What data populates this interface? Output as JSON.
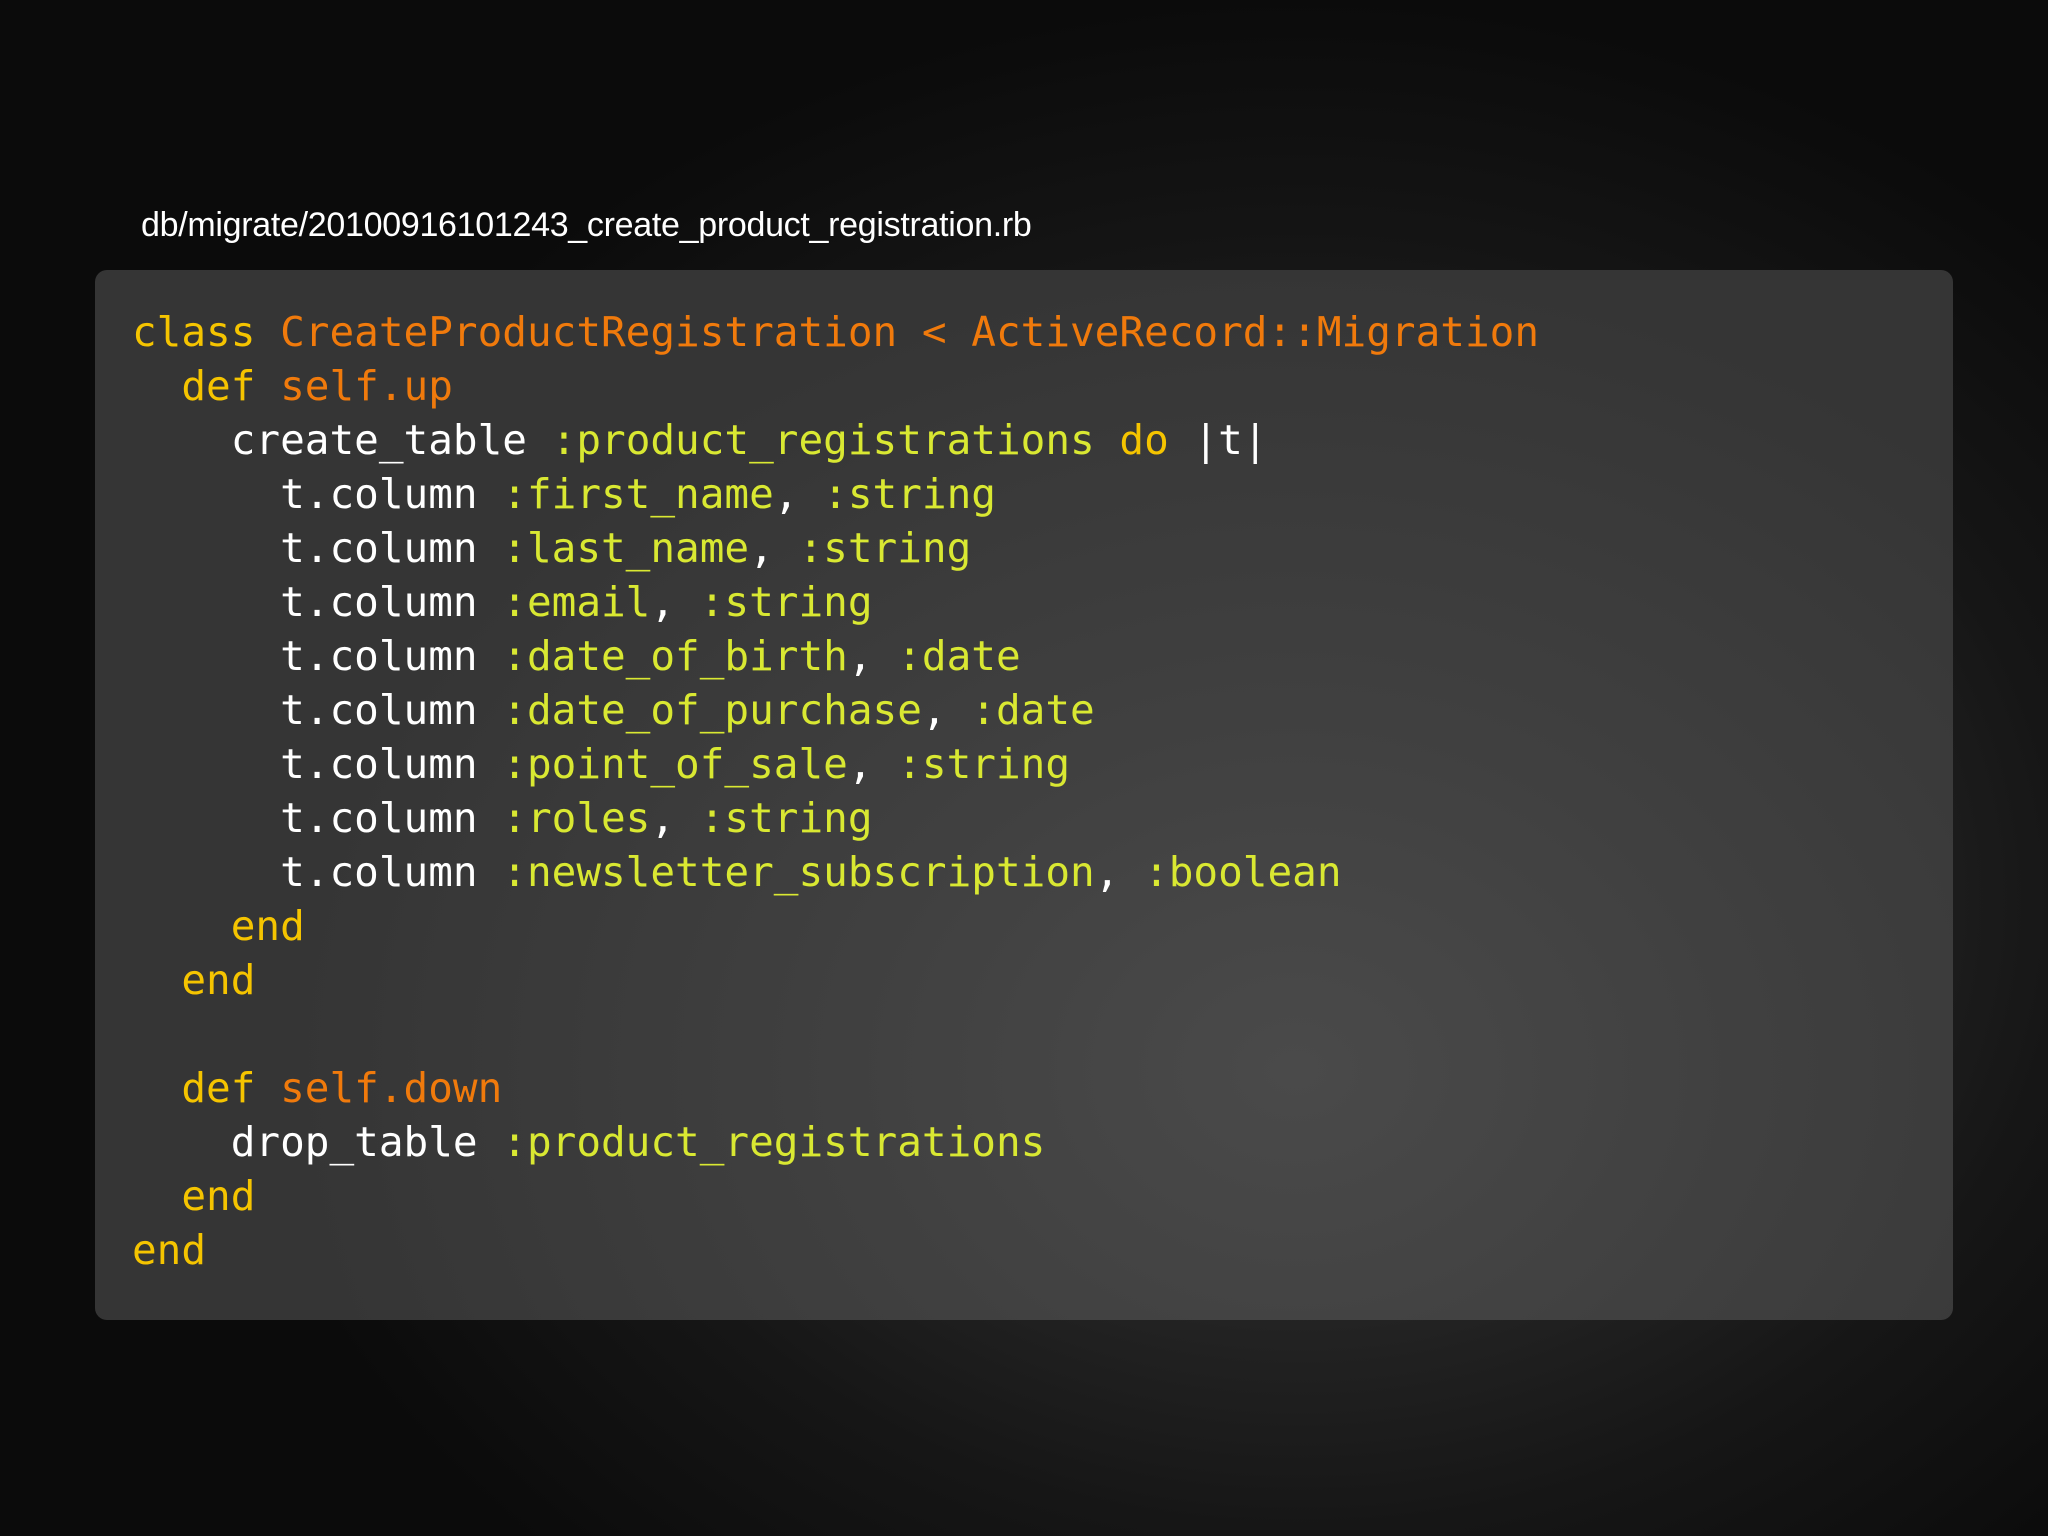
{
  "file_path": "db/migrate/20100916101243_create_product_registration.rb",
  "colors": {
    "keyword": "#f5c400",
    "class_name": "#f07a0c",
    "symbol": "#d9e832",
    "plain": "#ffffff"
  },
  "code_lines": [
    [
      {
        "text": "class",
        "kind": "keyword"
      },
      {
        "text": " ",
        "kind": "plain"
      },
      {
        "text": "CreateProductRegistration < ActiveRecord::Migration",
        "kind": "class_name"
      }
    ],
    [
      {
        "text": "  ",
        "kind": "plain"
      },
      {
        "text": "def",
        "kind": "keyword"
      },
      {
        "text": " ",
        "kind": "plain"
      },
      {
        "text": "self.up",
        "kind": "class_name"
      }
    ],
    [
      {
        "text": "    create_table ",
        "kind": "plain"
      },
      {
        "text": ":product_registrations",
        "kind": "symbol"
      },
      {
        "text": " ",
        "kind": "plain"
      },
      {
        "text": "do",
        "kind": "keyword"
      },
      {
        "text": " |t|",
        "kind": "plain"
      }
    ],
    [
      {
        "text": "      t.column ",
        "kind": "plain"
      },
      {
        "text": ":first_name",
        "kind": "symbol"
      },
      {
        "text": ", ",
        "kind": "plain"
      },
      {
        "text": ":string",
        "kind": "symbol"
      }
    ],
    [
      {
        "text": "      t.column ",
        "kind": "plain"
      },
      {
        "text": ":last_name",
        "kind": "symbol"
      },
      {
        "text": ", ",
        "kind": "plain"
      },
      {
        "text": ":string",
        "kind": "symbol"
      }
    ],
    [
      {
        "text": "      t.column ",
        "kind": "plain"
      },
      {
        "text": ":email",
        "kind": "symbol"
      },
      {
        "text": ", ",
        "kind": "plain"
      },
      {
        "text": ":string",
        "kind": "symbol"
      }
    ],
    [
      {
        "text": "      t.column ",
        "kind": "plain"
      },
      {
        "text": ":date_of_birth",
        "kind": "symbol"
      },
      {
        "text": ", ",
        "kind": "plain"
      },
      {
        "text": ":date",
        "kind": "symbol"
      }
    ],
    [
      {
        "text": "      t.column ",
        "kind": "plain"
      },
      {
        "text": ":date_of_purchase",
        "kind": "symbol"
      },
      {
        "text": ", ",
        "kind": "plain"
      },
      {
        "text": ":date",
        "kind": "symbol"
      }
    ],
    [
      {
        "text": "      t.column ",
        "kind": "plain"
      },
      {
        "text": ":point_of_sale",
        "kind": "symbol"
      },
      {
        "text": ", ",
        "kind": "plain"
      },
      {
        "text": ":string",
        "kind": "symbol"
      }
    ],
    [
      {
        "text": "      t.column ",
        "kind": "plain"
      },
      {
        "text": ":roles",
        "kind": "symbol"
      },
      {
        "text": ", ",
        "kind": "plain"
      },
      {
        "text": ":string",
        "kind": "symbol"
      }
    ],
    [
      {
        "text": "      t.column ",
        "kind": "plain"
      },
      {
        "text": ":newsletter_subscription",
        "kind": "symbol"
      },
      {
        "text": ", ",
        "kind": "plain"
      },
      {
        "text": ":boolean",
        "kind": "symbol"
      }
    ],
    [
      {
        "text": "    ",
        "kind": "plain"
      },
      {
        "text": "end",
        "kind": "keyword"
      }
    ],
    [
      {
        "text": "  ",
        "kind": "plain"
      },
      {
        "text": "end",
        "kind": "keyword"
      }
    ],
    [
      {
        "text": "",
        "kind": "plain"
      }
    ],
    [
      {
        "text": "  ",
        "kind": "plain"
      },
      {
        "text": "def",
        "kind": "keyword"
      },
      {
        "text": " ",
        "kind": "plain"
      },
      {
        "text": "self.down",
        "kind": "class_name"
      }
    ],
    [
      {
        "text": "    drop_table ",
        "kind": "plain"
      },
      {
        "text": ":product_registrations",
        "kind": "symbol"
      }
    ],
    [
      {
        "text": "  ",
        "kind": "plain"
      },
      {
        "text": "end",
        "kind": "keyword"
      }
    ],
    [
      {
        "text": "end",
        "kind": "keyword"
      }
    ]
  ]
}
